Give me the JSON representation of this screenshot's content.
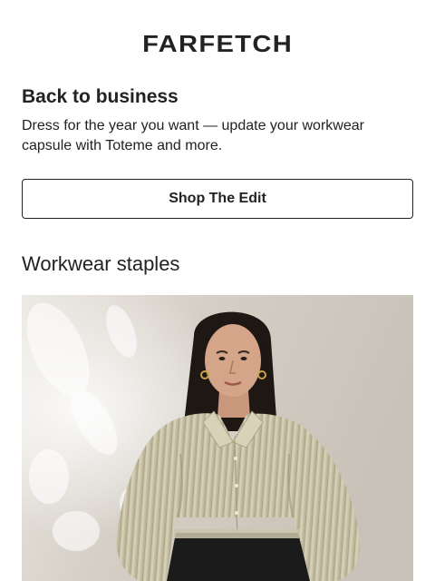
{
  "header": {
    "logo_text": "FARFETCH"
  },
  "hero_message": {
    "headline": "Back to business",
    "body": "Dress for the year you want — update your workwear capsule with Toteme and more.",
    "cta_label": "Shop The Edit"
  },
  "section": {
    "title": "Workwear staples"
  },
  "colors": {
    "text": "#222222",
    "background": "#ffffff",
    "photo_wall": "#d6d0c7",
    "shirt": "#cdc6ab",
    "trousers": "#1b1b1b"
  }
}
